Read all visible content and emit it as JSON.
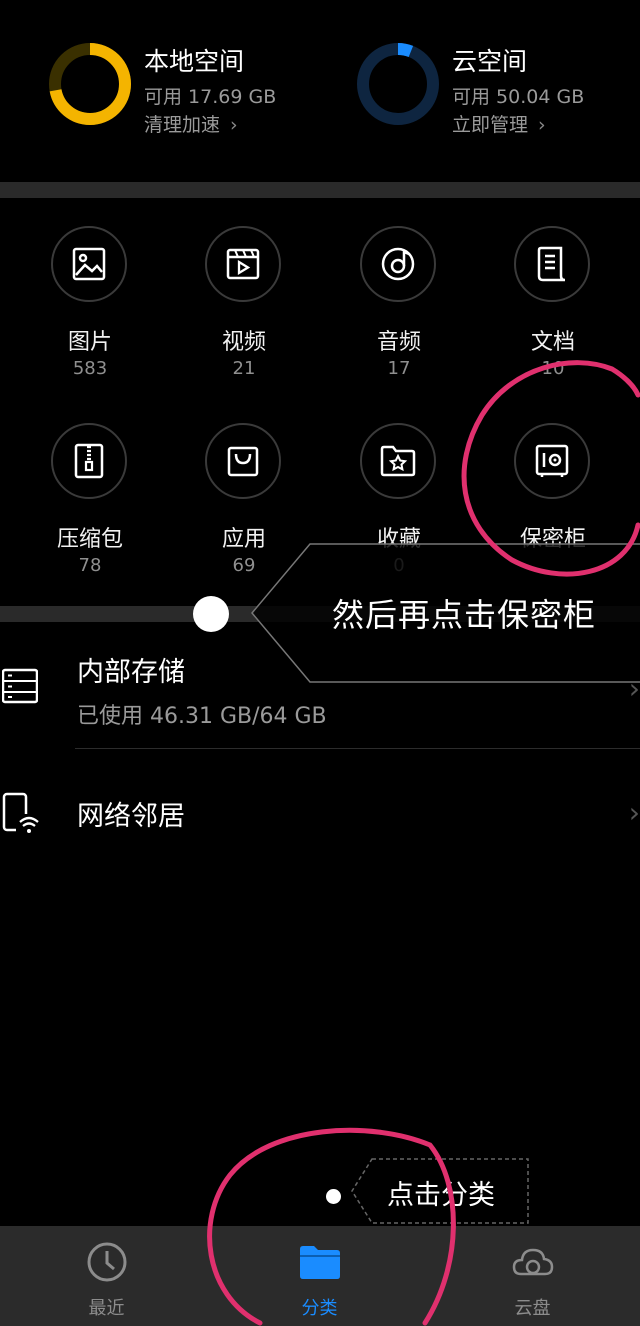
{
  "storage": {
    "local": {
      "title": "本地空间",
      "available": "可用 17.69 GB",
      "action": "清理加速",
      "ring_color": "#f4b400",
      "used_fraction": 0.72
    },
    "cloud": {
      "title": "云空间",
      "available": "可用 50.04 GB",
      "action": "立即管理",
      "ring_color": "#1a8cff",
      "used_fraction": 0.06
    }
  },
  "categories": [
    {
      "label": "图片",
      "count": "583",
      "icon": "image-icon"
    },
    {
      "label": "视频",
      "count": "21",
      "icon": "video-icon"
    },
    {
      "label": "音频",
      "count": "17",
      "icon": "audio-icon"
    },
    {
      "label": "文档",
      "count": "10",
      "icon": "document-icon"
    },
    {
      "label": "压缩包",
      "count": "78",
      "icon": "archive-icon"
    },
    {
      "label": "应用",
      "count": "69",
      "icon": "app-bag-icon"
    },
    {
      "label": "收藏",
      "count": "0",
      "icon": "favorite-folder-icon"
    },
    {
      "label": "保密柜",
      "count": "",
      "icon": "safe-icon"
    }
  ],
  "tutorial": {
    "callout": "然后再点击保密柜",
    "tip": "点击分类",
    "highlight_color": "#e0306e"
  },
  "list": {
    "internal": {
      "title": "内部存储",
      "subtitle": "已使用 46.31 GB/64 GB"
    },
    "network": {
      "title": "网络邻居"
    }
  },
  "nav": {
    "recent": "最近",
    "category": "分类",
    "cloud": "云盘",
    "active_color": "#1a8cff"
  }
}
